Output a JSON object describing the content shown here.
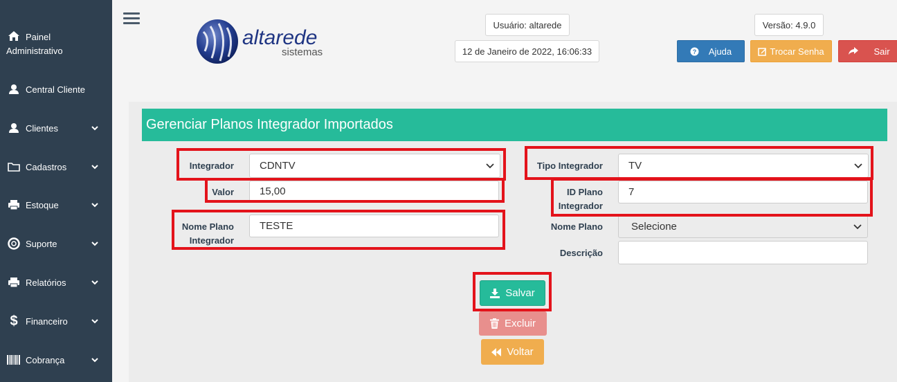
{
  "sidebar": {
    "items": [
      {
        "label": "Painel Administrativo",
        "icon": "home-icon",
        "has_chevron": false
      },
      {
        "label": "Central Cliente",
        "icon": "user-icon",
        "has_chevron": false
      },
      {
        "label": "Clientes",
        "icon": "user-icon",
        "has_chevron": true
      },
      {
        "label": "Cadastros",
        "icon": "folder-icon",
        "has_chevron": true
      },
      {
        "label": "Estoque",
        "icon": "printer-icon",
        "has_chevron": true
      },
      {
        "label": "Suporte",
        "icon": "lifebuoy-icon",
        "has_chevron": true
      },
      {
        "label": "Relatórios",
        "icon": "printer-icon",
        "has_chevron": true
      },
      {
        "label": "Financeiro",
        "icon": "dollar-icon",
        "has_chevron": true
      },
      {
        "label": "Cobrança",
        "icon": "barcode-icon",
        "has_chevron": true
      }
    ]
  },
  "header": {
    "logo_name": "altarede",
    "logo_sub": "sistemas",
    "user": "Usuário: altarede",
    "datetime": "12 de Janeiro de 2022, 16:06:33",
    "version": "Versão: 4.9.0",
    "help_label": "Ajuda",
    "change_password_label": "Trocar Senha",
    "exit_label": "Sair"
  },
  "form": {
    "title": "Gerenciar Planos Integrador Importados",
    "integrador_label": "Integrador",
    "integrador_value": "CDNTV",
    "valor_label": "Valor",
    "valor_value": "15,00",
    "nome_plano_integrador_label_1": "Nome Plano",
    "nome_plano_integrador_label_2": "Integrador",
    "nome_plano_integrador_value": "TESTE",
    "tipo_integrador_label": "Tipo Integrador",
    "tipo_integrador_value": "TV",
    "id_plano_label_1": "ID Plano",
    "id_plano_label_2": "Integrador",
    "id_plano_value": "7",
    "nome_plano_label": "Nome Plano",
    "nome_plano_value": "Selecione",
    "descricao_label": "Descrição",
    "descricao_value": ""
  },
  "actions": {
    "save_label": "Salvar",
    "delete_label": "Excluir",
    "back_label": "Voltar"
  },
  "colors": {
    "sidebar_bg": "#2f4050",
    "title_bar": "#26bb9a",
    "help_btn": "#337ab7",
    "change_password_btn": "#f0ad4e",
    "exit_btn": "#d9534f",
    "save_btn": "#26bb9a",
    "delete_btn": "#e88f8d",
    "back_btn": "#f0ad4e",
    "highlight": "#e3131b"
  }
}
